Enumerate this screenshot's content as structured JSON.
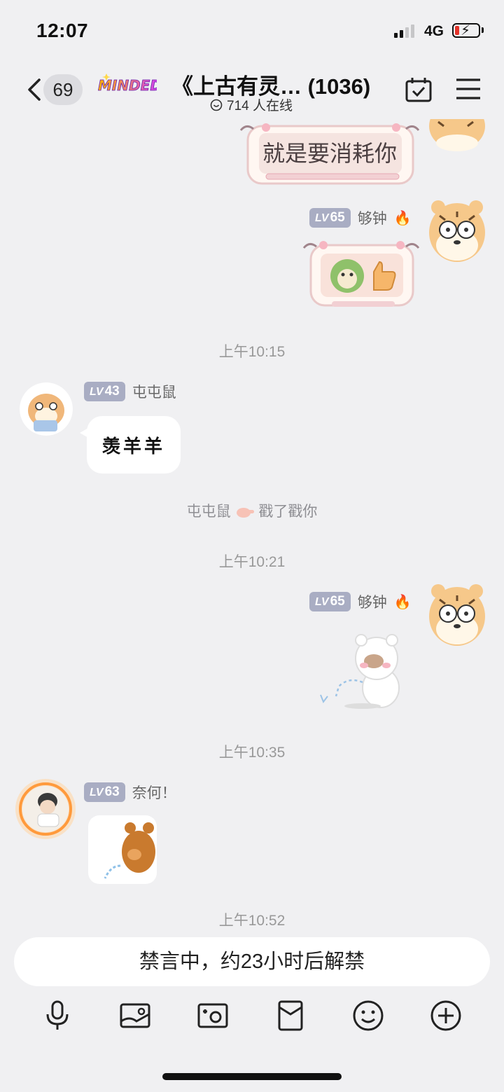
{
  "status_bar": {
    "time": "12:07",
    "network": "4G"
  },
  "header": {
    "back_count": "69",
    "brand": "MINDED",
    "title": "《上古有灵… (1036)",
    "online_text": "714 人在线"
  },
  "messages": [
    {
      "type": "sticker",
      "side": "right",
      "caption": "就是要消耗你"
    },
    {
      "type": "sticker",
      "side": "right",
      "level_prefix": "LV",
      "level": "65",
      "sender": "够钟",
      "sticker_desc": "cabbage-thumbs-up"
    },
    {
      "type": "timestamp",
      "text": "上午10:15"
    },
    {
      "type": "text",
      "side": "left",
      "level_prefix": "LV",
      "level": "43",
      "sender": "屯屯鼠",
      "text": "羡羊羊"
    },
    {
      "type": "system",
      "actor": "屯屯鼠",
      "action": "戳了戳你"
    },
    {
      "type": "timestamp",
      "text": "上午10:21"
    },
    {
      "type": "sticker",
      "side": "right",
      "level_prefix": "LV",
      "level": "65",
      "sender": "够钟",
      "sticker_desc": "white-bear-meme"
    },
    {
      "type": "timestamp",
      "text": "上午10:35"
    },
    {
      "type": "sticker",
      "side": "left",
      "level_prefix": "LV",
      "level": "63",
      "sender": "奈何！",
      "sticker_desc": "brown-bear"
    },
    {
      "type": "timestamp",
      "text": "上午10:52"
    }
  ],
  "input": {
    "muted_text": "禁言中，约23小时后解禁"
  },
  "toolbar": [
    "microphone-icon",
    "image-icon",
    "camera-icon",
    "red-packet-icon",
    "emoji-icon",
    "plus-icon"
  ],
  "colors": {
    "background": "#f0f0f2",
    "level_badge": "#a9adc3",
    "timestamp": "#999999"
  }
}
